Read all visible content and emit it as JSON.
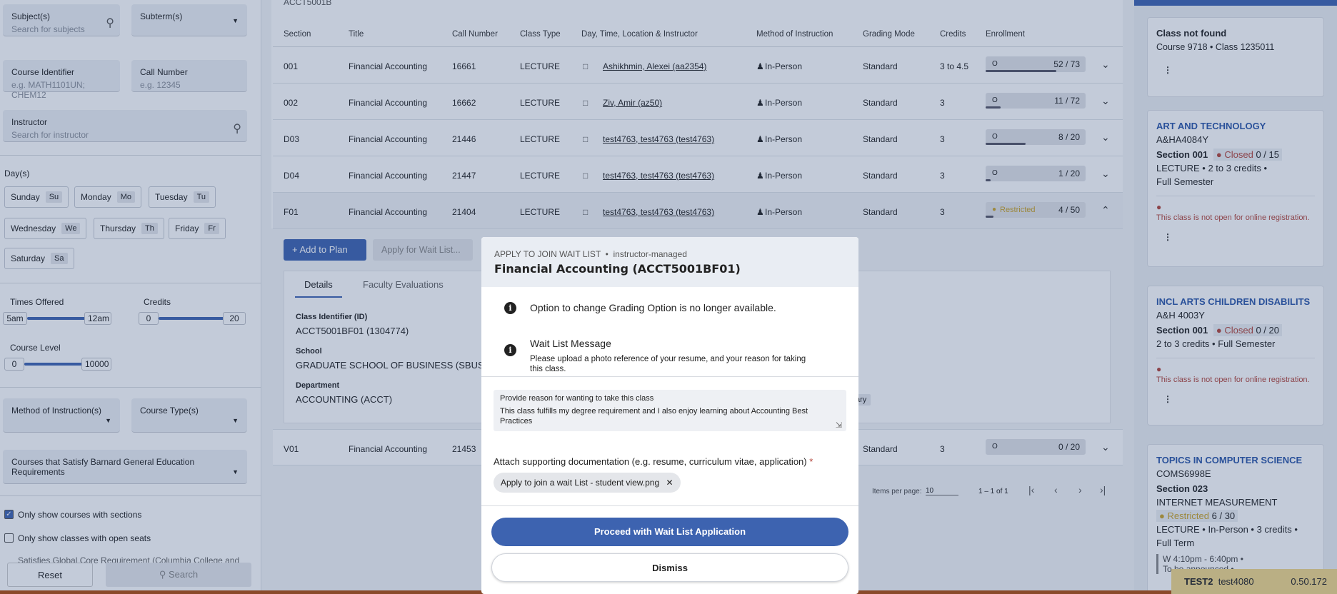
{
  "filters": {
    "subjects": {
      "label": "Subject(s)",
      "placeholder": "Search for subjects"
    },
    "subterms": {
      "label": "Subterm(s)"
    },
    "course_identifier": {
      "label": "Course Identifier",
      "placeholder": "e.g. MATH1101UN; CHEM12"
    },
    "call_number": {
      "label": "Call Number",
      "placeholder": "e.g. 12345"
    },
    "instructor": {
      "label": "Instructor",
      "placeholder": "Search for instructor"
    },
    "days_label": "Day(s)",
    "days": [
      {
        "name": "Sunday",
        "abbr": "Su"
      },
      {
        "name": "Monday",
        "abbr": "Mo"
      },
      {
        "name": "Tuesday",
        "abbr": "Tu"
      },
      {
        "name": "Wednesday",
        "abbr": "We"
      },
      {
        "name": "Thursday",
        "abbr": "Th"
      },
      {
        "name": "Friday",
        "abbr": "Fr"
      },
      {
        "name": "Saturday",
        "abbr": "Sa"
      }
    ],
    "times": {
      "label": "Times Offered",
      "min": "5am",
      "max": "12am"
    },
    "credits": {
      "label": "Credits",
      "min": "0",
      "max": "20"
    },
    "course_level": {
      "label": "Course Level",
      "min": "0",
      "max": "10000"
    },
    "method": {
      "label": "Method of Instruction(s)"
    },
    "course_type": {
      "label": "Course Type(s)"
    },
    "barnard": {
      "label": "Courses that Satisfy Barnard General Education Requirements"
    },
    "only_sections": {
      "label": "Only show courses with sections",
      "checked": true
    },
    "open_seats": {
      "label": "Only show classes with open seats",
      "checked": false
    },
    "global_core": {
      "label": "Satisfies Global Core Requirement (Columbia College and"
    },
    "reset_label": "Reset",
    "search_label": "Search"
  },
  "table": {
    "course_code": "ACCT5001B",
    "headers": {
      "section": "Section",
      "title": "Title",
      "call": "Call Number",
      "type": "Class Type",
      "daytime": "Day, Time, Location & Instructor",
      "method": "Method of Instruction",
      "grading": "Grading Mode",
      "credits": "Credits",
      "enrollment": "Enrollment"
    },
    "rows": [
      {
        "section": "001",
        "title": "Financial Accounting",
        "call": "16661",
        "type": "LECTURE",
        "instructor": "Ashikhmin, Alexei (aa2354)",
        "method": "In-Person",
        "grading": "Standard",
        "credits": "3 to 4.5",
        "status": "",
        "enrollment": "52 / 73",
        "fill": 0.71
      },
      {
        "section": "002",
        "title": "Financial Accounting",
        "call": "16662",
        "type": "LECTURE",
        "instructor": "Ziv, Amir (az50)",
        "method": "In-Person",
        "grading": "Standard",
        "credits": "3",
        "status": "",
        "enrollment": "11 / 72",
        "fill": 0.15
      },
      {
        "section": "D03",
        "title": "Financial Accounting",
        "call": "21446",
        "type": "LECTURE",
        "instructor": "test4763, test4763 (test4763)",
        "method": "In-Person",
        "grading": "Standard",
        "credits": "3",
        "status": "",
        "enrollment": "8 / 20",
        "fill": 0.4
      },
      {
        "section": "D04",
        "title": "Financial Accounting",
        "call": "21447",
        "type": "LECTURE",
        "instructor": "test4763, test4763 (test4763)",
        "method": "In-Person",
        "grading": "Standard",
        "credits": "3",
        "status": "",
        "enrollment": "1 / 20",
        "fill": 0.05
      },
      {
        "section": "F01",
        "title": "Financial Accounting",
        "call": "21404",
        "type": "LECTURE",
        "instructor": "test4763, test4763 (test4763)",
        "method": "In-Person",
        "grading": "Standard",
        "credits": "3",
        "status": "Restricted",
        "enrollment": "4 / 50",
        "fill": 0.08
      }
    ],
    "last_row": {
      "section": "V01",
      "title": "Financial Accounting",
      "call": "21453",
      "grading": "Standard",
      "credits": "3",
      "enrollment": "0 / 20"
    },
    "add_to_plan": "Add to Plan",
    "apply_wait_list": "Apply for Wait List...",
    "tabs": [
      "Details",
      "Faculty Evaluations"
    ],
    "details": {
      "class_id_label": "Class Identifier (ID)",
      "class_id": "ACCT5001BF01 (1304774)",
      "school_label": "School",
      "school": "GRADUATE SCHOOL OF BUSINESS (SBUS)",
      "dept_label": "Department",
      "dept": "ACCOUNTING (ACCT)",
      "partial": "ary"
    },
    "pager": {
      "items_label": "Items per page:",
      "items": "10",
      "range": "1 – 1 of 1"
    }
  },
  "cards": [
    {
      "title": "Class not found",
      "sub": "Course 9718 • Class 1235011"
    },
    {
      "title": "ART AND TECHNOLOGY",
      "code": "A&HA4084Y",
      "section": "Section 001",
      "status": "Closed",
      "count": "0 / 15",
      "line1": "LECTURE • 2 to 3 credits •",
      "line2": "Full Semester",
      "warn": "This class is not open for online registration."
    },
    {
      "title": "INCL ARTS CHILDREN DISABILITS",
      "code": "A&H 4003Y",
      "section": "Section 001",
      "status": "Closed",
      "count": "0 / 20",
      "line1": "2 to 3 credits • Full Semester",
      "warn": "This class is not open for online registration."
    },
    {
      "title": "TOPICS IN COMPUTER SCIENCE",
      "code": "COMS6998E",
      "section": "Section 023",
      "line0": "INTERNET MEASUREMENT",
      "status": "Restricted",
      "count": "6 / 30",
      "line1": "LECTURE • In-Person • 3 credits •",
      "line2": "Full Term",
      "partial1": "W 4:10pm - 6:40pm •",
      "partial2": "To be announced •"
    }
  ],
  "footer_tag": {
    "name": "TEST2",
    "user": "test4080",
    "version": "0.50.172"
  },
  "modal": {
    "header_small": "APPLY TO JOIN WAIT LIST",
    "header_tag": "instructor-managed",
    "title": "Financial Accounting (ACCT5001BF01)",
    "info1": "Option to change Grading Option is no longer available.",
    "info2_title": "Wait List Message",
    "info2_text": "Please upload a photo reference of your resume, and your reason for taking this class.",
    "reason_label": "Provide reason for wanting to take this class",
    "reason_value": "This class fulfills my degree requirement and I also enjoy learning about Accounting Best Practices",
    "attach_label": "Attach supporting documentation (e.g. resume, curriculum vitae, application)",
    "attach_required": "*",
    "file_name": "Apply to join a wait List - student view.png",
    "proceed": "Proceed with Wait List Application",
    "dismiss": "Dismiss"
  },
  "colors": {
    "accent": "#3d63b0",
    "closed": "#b3443a",
    "restricted": "#c9a227"
  }
}
